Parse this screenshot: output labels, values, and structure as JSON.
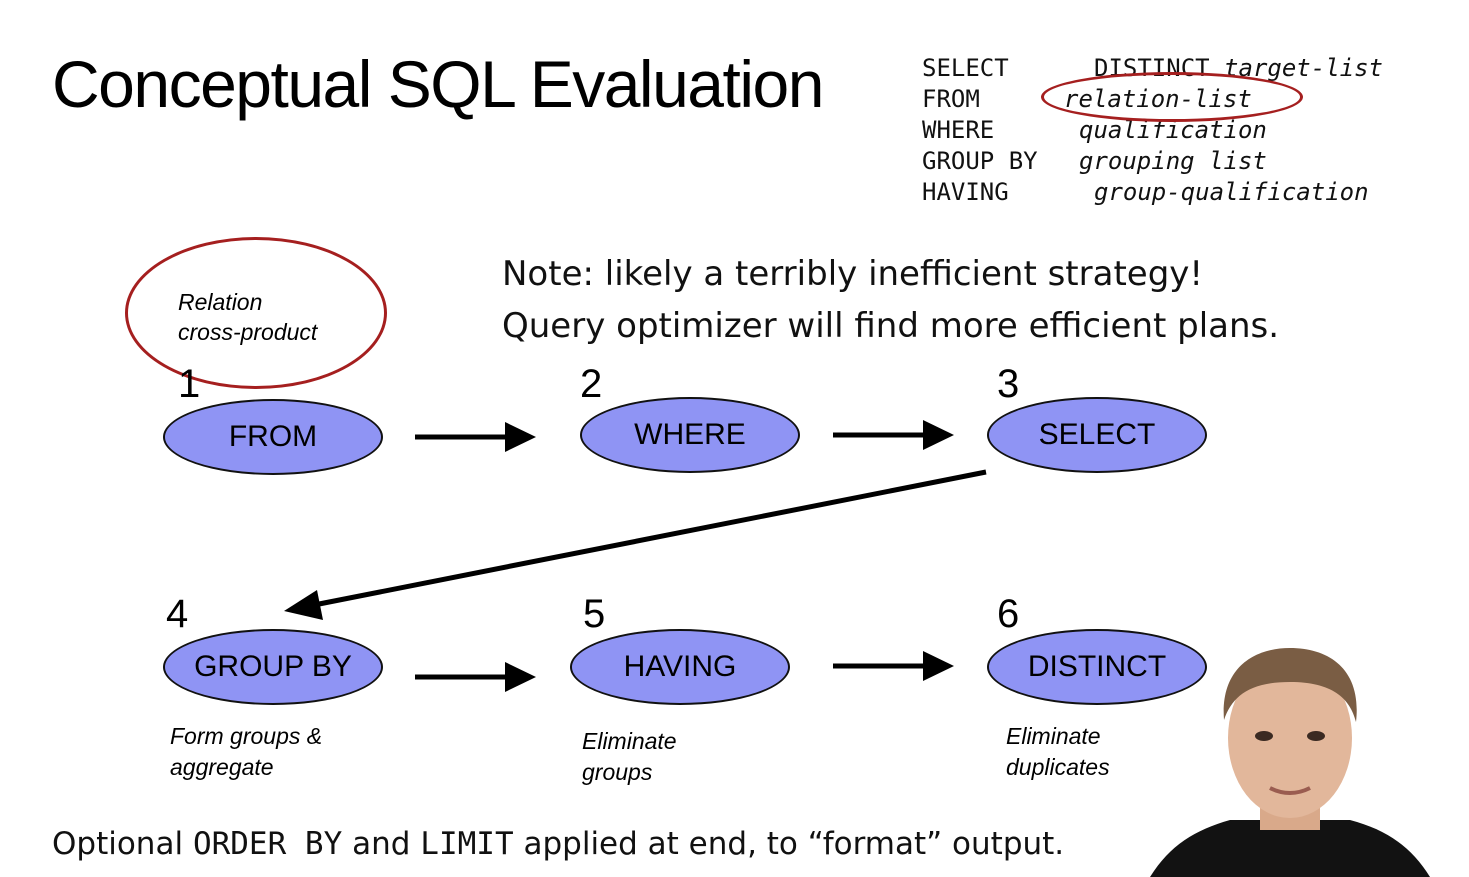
{
  "title": "Conceptual SQL Evaluation",
  "syntax": [
    {
      "keyword": "SELECT",
      "arg": "DISTINCT target-list"
    },
    {
      "keyword": "FROM",
      "arg": "relation-list"
    },
    {
      "keyword": "WHERE",
      "arg": "qualification"
    },
    {
      "keyword": "GROUP BY",
      "arg": "grouping list"
    },
    {
      "keyword": "HAVING",
      "arg": "group-qualification"
    }
  ],
  "note": [
    "Note: likely a terribly inefficient strategy!",
    "Query optimizer will find more efficient plans."
  ],
  "annotation": [
    "Relation",
    "cross-product"
  ],
  "steps": [
    {
      "number": "1",
      "label": "FROM"
    },
    {
      "number": "2",
      "label": "WHERE"
    },
    {
      "number": "3",
      "label": "SELECT"
    },
    {
      "number": "4",
      "label": "GROUP BY",
      "caption": [
        "Form groups &",
        "aggregate"
      ]
    },
    {
      "number": "5",
      "label": "HAVING",
      "caption": [
        "Eliminate",
        "groups"
      ]
    },
    {
      "number": "6",
      "label": "DISTINCT",
      "caption": [
        "Eliminate",
        "duplicates"
      ]
    }
  ],
  "footer": {
    "prefix": "Optional",
    "kw1": "ORDER BY",
    "and": "and",
    "kw2": "LIMIT",
    "suffix": "applied at end, to “format” output."
  },
  "colors": {
    "node_fill": "#8f94f4",
    "highlight": "#a51f1f"
  }
}
